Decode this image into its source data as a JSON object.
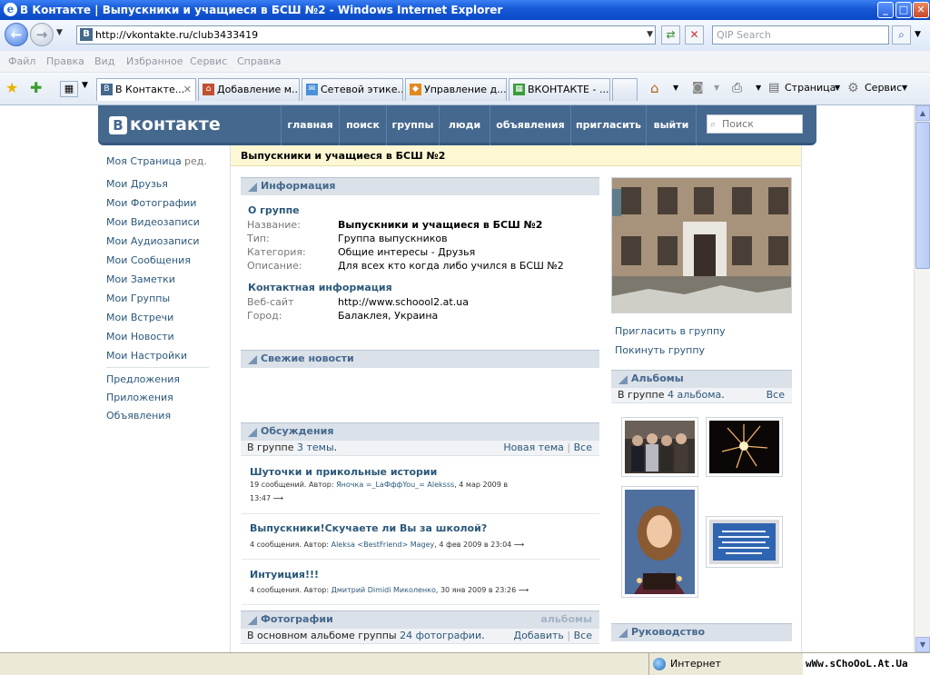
{
  "window": {
    "title": "В Контакте | Выпускники и учащиеся в БСШ №2 - Windows Internet Explorer"
  },
  "address": {
    "url": "http://vkontakte.ru/club3433419",
    "search_placeholder": "QIP Search"
  },
  "menu": [
    "Файл",
    "Правка",
    "Вид",
    "Избранное",
    "Сервис",
    "Справка"
  ],
  "tabs": [
    {
      "label": "В Контакте...",
      "fav": "B",
      "color": "#45688e"
    },
    {
      "label": "Добавление м...",
      "fav": "⌂",
      "color": "#c05030"
    },
    {
      "label": "Сетевой этике...",
      "fav": "✉",
      "color": "#4a8fd8"
    },
    {
      "label": "Управление д...",
      "fav": "◆",
      "color": "#e08a20"
    },
    {
      "label": "ВКОНТАКТЕ - ...",
      "fav": "▦",
      "color": "#3b9d3b"
    }
  ],
  "toolbar": {
    "page": "Страница",
    "service": "Сервис"
  },
  "vk": {
    "logo": "контакте",
    "logo_letter": "B",
    "nav": [
      "главная",
      "поиск",
      "группы",
      "люди",
      "объявления",
      "пригласить",
      "выйти"
    ],
    "search_placeholder": "Поиск"
  },
  "left_menu": {
    "my_page": "Моя Страница",
    "edit": "ред.",
    "items": [
      "Мои Друзья",
      "Мои Фотографии",
      "Мои Видеозаписи",
      "Мои Аудиозаписи",
      "Мои Сообщения",
      "Мои Заметки",
      "Мои Группы",
      "Мои Встречи",
      "Мои Новости",
      "Мои Настройки"
    ],
    "extra": [
      "Предложения",
      "Приложения",
      "Объявления"
    ]
  },
  "group": {
    "title": "Выпускники и учащиеся в БСШ №2",
    "info_header": "Информация",
    "about_header": "О группе",
    "fields": [
      {
        "label": "Название:",
        "value": "Выпускники и учащиеся в БСШ №2"
      },
      {
        "label": "Тип:",
        "value": "Группа выпускников"
      },
      {
        "label": "Категория:",
        "value": "Общие интересы - Друзья"
      },
      {
        "label": "Описание:",
        "value": "Для всех кто когда либо учился в БСШ №2"
      }
    ],
    "contact_header": "Контактная информация",
    "contacts": [
      {
        "label": "Веб-сайт",
        "value": "http://www.schoool2.at.ua"
      },
      {
        "label": "Город:",
        "value": "Балаклея, Украина"
      }
    ],
    "news_header": "Свежие новости",
    "discuss_header": "Обсуждения",
    "discuss_count_pre": "В группе",
    "discuss_count": "3 темы",
    "new_topic": "Новая тема",
    "all": "Все",
    "topics": [
      {
        "title": "Шуточки и прикольные истории",
        "count": "19 сообщений. Автор:",
        "author": "Яночка =_LaФффYou_= Aleksss",
        "date": "4 мар 2009 в",
        "date2": "13:47 ⟶"
      },
      {
        "title": "Выпускники!Скучаете ли Вы за школой?",
        "count": "4 сообщения. Автор:",
        "author": "Aleksa <BestFriend> Magey",
        "date": "4 фев 2009 в 23:04 ⟶"
      },
      {
        "title": "Интуиция!!!",
        "count": "4 сообщения. Автор:",
        "author": "Дмитрий Dimidi Миколенко",
        "date": "30 янв 2009 в 23:26 ⟶"
      }
    ],
    "photos_header": "Фотографии",
    "albums_link": "альбомы",
    "photos_text_pre": "В основном альбоме группы",
    "photos_count": "24 фотографии",
    "add": "Добавить"
  },
  "right": {
    "invite": "Пригласить в группу",
    "leave": "Покинуть группу",
    "albums_header": "Альбомы",
    "albums_pre": "В группе",
    "albums_count": "4 альбома",
    "all": "Все",
    "leaders_header": "Руководство"
  },
  "status": {
    "zone": "Интернет",
    "watermark": "wWw.sChoOoL.At.Ua"
  }
}
